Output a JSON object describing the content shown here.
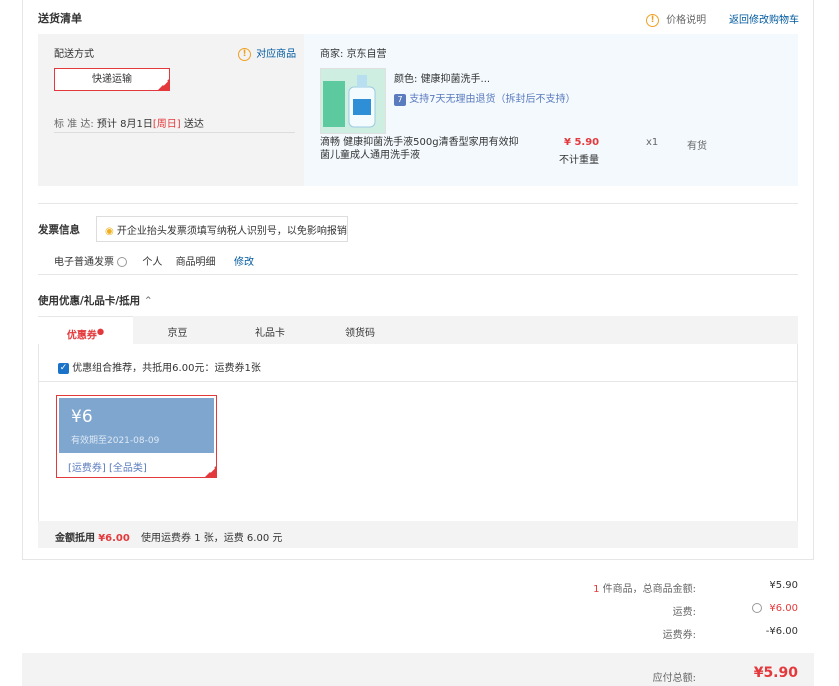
{
  "header": {
    "title": "送货清单",
    "price_note": "价格说明",
    "back_to_cart": "返回修改购物车"
  },
  "delivery": {
    "method_label": "配送方式",
    "related_goods": "对应商品",
    "method_option": "快递运输",
    "eta_label": "标 准 达:",
    "eta_prefix": "预计 8月1日",
    "eta_day": "[周日]",
    "eta_suffix": "送达"
  },
  "merchant": {
    "label": "商家:",
    "name": "京东自营"
  },
  "product": {
    "color_label": "颜色:",
    "color_value": "健康抑菌洗手...",
    "return_badge": "7",
    "return_policy": "支持7天无理由退货（拆封后不支持）",
    "name": "滴畅 健康抑菌洗手液500g清香型家用有效抑菌儿童成人通用洗手液",
    "price": "¥ 5.90",
    "weight_note": "不计重量",
    "quantity": "x1",
    "stock": "有货"
  },
  "invoice": {
    "title": "发票信息",
    "tip": "开企业抬头发票须填写纳税人识别号，以免影响报销",
    "type": "电子普通发票",
    "holder": "个人",
    "content": "商品明细",
    "edit": "修改"
  },
  "coupons": {
    "title": "使用优惠/礼品卡/抵用",
    "tabs": [
      "优惠券",
      "京豆",
      "礼品卡",
      "领货码"
    ],
    "combo_text": "优惠组合推荐，共抵用6.00元：运费券1张",
    "coupon_amount": "¥6",
    "coupon_expiry": "有效期至2021-08-09",
    "coupon_tag1": "[运费券]",
    "coupon_tag2": "[全品类]",
    "summary_label": "金额抵用",
    "summary_amount": "¥6.00",
    "summary_detail": "使用运费券 1 张，运费 6.00 元"
  },
  "totals": {
    "count": "1",
    "goods_label": "件商品，总商品金额:",
    "goods_amount": "¥5.90",
    "freight_label": "运费:",
    "freight_amount": "¥6.00",
    "freight_coupon_label": "运费券:",
    "freight_coupon_amount": "-¥6.00",
    "payable_label": "应付总额:",
    "payable_amount": "¥5.90"
  },
  "colors": {
    "accent_red": "#e4393c",
    "link_blue": "#005aa0",
    "coupon_blue": "#7fa6cf",
    "panel_bg": "#f3f3f3",
    "product_bg": "#f3f9fd"
  }
}
